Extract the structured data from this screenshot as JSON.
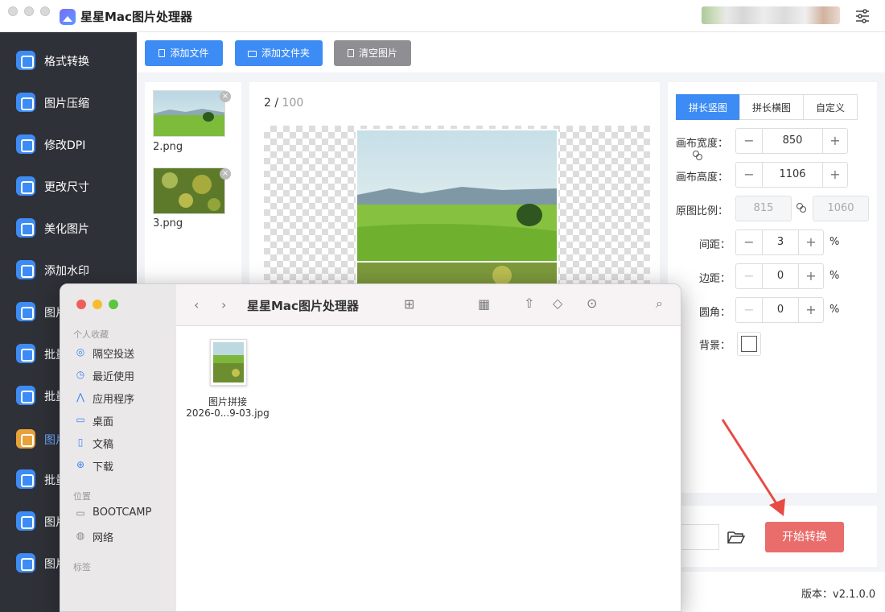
{
  "app": {
    "title": "星星Mac图片处理器"
  },
  "sidebar": {
    "items": [
      {
        "label": "格式转换",
        "icon": "format-convert-icon"
      },
      {
        "label": "图片压缩",
        "icon": "compress-icon"
      },
      {
        "label": "修改DPI",
        "icon": "dpi-icon"
      },
      {
        "label": "更改尺寸",
        "icon": "resize-icon"
      },
      {
        "label": "美化图片",
        "icon": "beautify-icon"
      },
      {
        "label": "添加水印",
        "icon": "watermark-icon"
      },
      {
        "label": "图片",
        "icon": "image-tool-icon"
      },
      {
        "label": "批量",
        "icon": "batch-rotate-icon"
      },
      {
        "label": "批量",
        "icon": "batch-rename-icon"
      },
      {
        "label": "图片",
        "icon": "puzzle-icon"
      },
      {
        "label": "批量",
        "icon": "batch-crop-icon"
      },
      {
        "label": "图片",
        "icon": "frame-icon"
      },
      {
        "label": "图片",
        "icon": "layers-icon"
      }
    ]
  },
  "toolbar": {
    "add_file": "添加文件",
    "add_folder": "添加文件夹",
    "clear": "清空图片"
  },
  "files": [
    {
      "name": "2.png"
    },
    {
      "name": "3.png"
    }
  ],
  "preview": {
    "current": "2",
    "total": "100"
  },
  "panel": {
    "tabs": [
      "拼长竖图",
      "拼长横图",
      "自定义"
    ],
    "canvas_width_label": "画布宽度：",
    "canvas_width": "850",
    "canvas_height_label": "画布高度：",
    "canvas_height": "1106",
    "ratio_label": "原图比例：",
    "ratio_w": "815",
    "ratio_h": "1060",
    "spacing_label": "间距：",
    "spacing": "3",
    "margin_label": "边距：",
    "margin": "0",
    "radius_label": "圆角：",
    "radius": "0",
    "bg_label": "背景：",
    "unit": "%"
  },
  "start_button": "开始转换",
  "version": "版本：v2.1.0.0",
  "finder": {
    "title": "星星Mac图片处理器",
    "favorites_head": "个人收藏",
    "favorites": [
      "隔空投送",
      "最近使用",
      "应用程序",
      "桌面",
      "文稿",
      "下载"
    ],
    "locations_head": "位置",
    "locations": [
      "BOOTCAMP",
      "网络"
    ],
    "tags_head": "标签",
    "file_name_1": "图片拼接",
    "file_name_2": "2026-0...9-03.jpg"
  },
  "colors": {
    "accent": "#3d8cf5",
    "start": "#e96d6b",
    "sidebar": "#2f3138"
  }
}
